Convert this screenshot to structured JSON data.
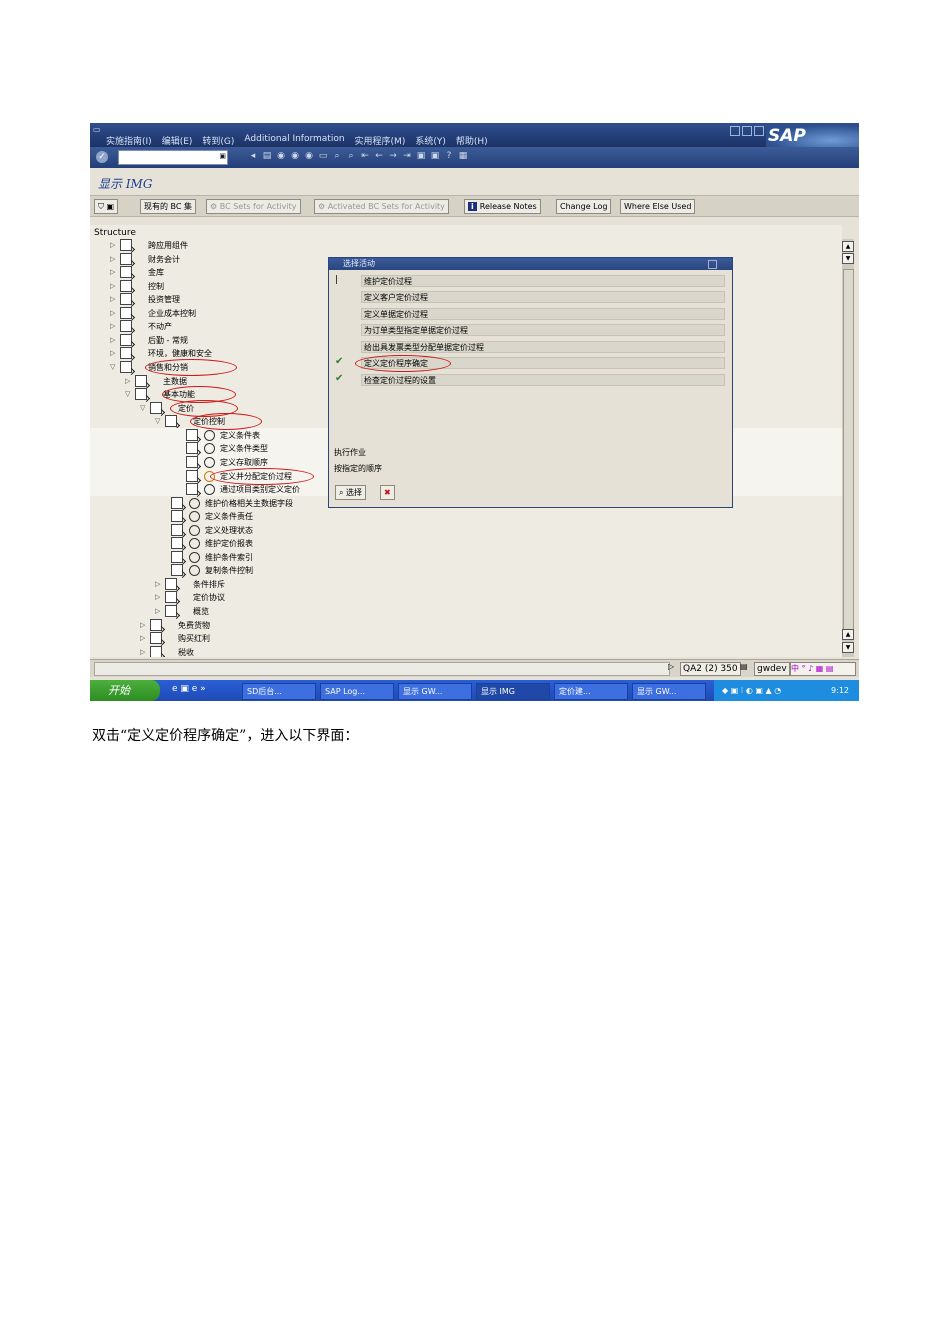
{
  "window": {
    "menu": [
      "实施指南(I)",
      "编辑(E)",
      "转到(G)",
      "Additional Information",
      "实用程序(M)",
      "系统(Y)",
      "帮助(H)"
    ],
    "logo_text": "SAP",
    "command_field_value": ""
  },
  "screen_title": "显示 IMG",
  "app_toolbar": {
    "existing_bc": "现有的 BC 集",
    "bc_sets_activity": "BC Sets for Activity",
    "activated_bc_sets": "Activated BC Sets for Activity",
    "release_notes_icon": "i",
    "release_notes": "Release Notes",
    "change_log": "Change Log",
    "where_else_used": "Where Else Used"
  },
  "tree": {
    "header": "Structure",
    "items": [
      "跨应用组件",
      "财务会计",
      "金库",
      "控制",
      "投资管理",
      "企业成本控制",
      "不动产",
      "后勤 - 常规",
      "环境，健康和安全",
      "销售和分销",
      "主数据",
      "基本功能",
      "定价",
      "定价控制",
      "定义条件表",
      "定义条件类型",
      "定义存取顺序",
      "定义并分配定价过程",
      "通过项目类别定义定价",
      "维护价格相关主数据字段",
      "定义条件责任",
      "定义处理状态",
      "维护定价报表",
      "维护条件索引",
      "复制条件控制",
      "条件排斥",
      "定价协议",
      "概览",
      "免费货物",
      "购买红利",
      "税收"
    ]
  },
  "dialog": {
    "title": "选择活动",
    "activities": [
      "维护定价过程",
      "定义客户定价过程",
      "定义单据定价过程",
      "为订单类型指定单据定价过程",
      "给出具发票类型分配单据定价过程",
      "定义定价程序确定",
      "检查定价过程的设置"
    ],
    "footer_line1": "执行作业",
    "footer_line2": "按指定的顺序",
    "select_button": "选择",
    "cancel_button": "✖"
  },
  "status_bar": {
    "system": "QA2 (2) 350",
    "server": "gwdev"
  },
  "taskbar": {
    "start": "开始",
    "tasks": [
      "SD后台...",
      "SAP Log...",
      "显示 GW...",
      "显示 IMG",
      "定价建...",
      "显示 GW..."
    ],
    "clock": "9:12"
  },
  "caption": "双击“定义定价程序确定”，进入以下界面："
}
